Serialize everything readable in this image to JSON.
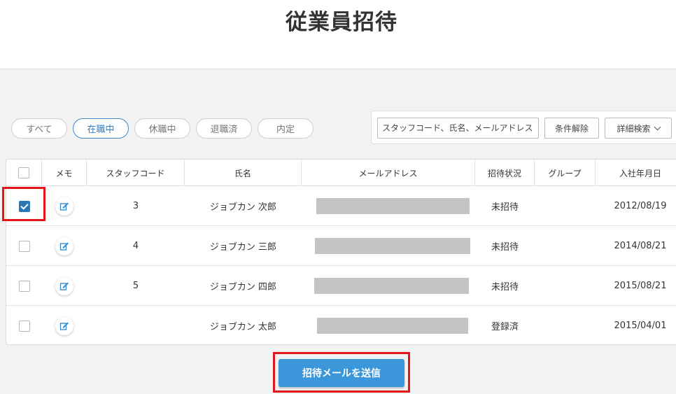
{
  "page": {
    "title": "従業員招待"
  },
  "filters": {
    "tabs": [
      {
        "label": "すべて",
        "active": false
      },
      {
        "label": "在職中",
        "active": true
      },
      {
        "label": "休職中",
        "active": false
      },
      {
        "label": "退職済",
        "active": false
      },
      {
        "label": "内定",
        "active": false
      }
    ]
  },
  "search": {
    "placeholder": "スタッフコード、氏名、メールアドレス",
    "value": "",
    "clear_label": "条件解除",
    "advanced_label": "詳細検索"
  },
  "table": {
    "columns": [
      "メモ",
      "スタッフコード",
      "氏名",
      "メールアドレス",
      "招待状況",
      "グループ",
      "入社年月日"
    ],
    "rows": [
      {
        "checked": true,
        "code": "3",
        "name": "ジョブカン 次郎",
        "status": "未招待",
        "group": "",
        "join_date": "2012/08/19"
      },
      {
        "checked": false,
        "code": "4",
        "name": "ジョブカン 三郎",
        "status": "未招待",
        "group": "",
        "join_date": "2014/08/21"
      },
      {
        "checked": false,
        "code": "5",
        "name": "ジョブカン 四郎",
        "status": "未招待",
        "group": "",
        "join_date": "2015/08/21"
      },
      {
        "checked": false,
        "code": "",
        "name": "ジョブカン 太郎",
        "status": "登録済",
        "group": "",
        "join_date": "2015/04/01"
      }
    ]
  },
  "actions": {
    "send_label": "招待メールを送信"
  },
  "colors": {
    "accent": "#3b97d9",
    "highlight": "#e3151a",
    "checkbox_checked": "#2b78b8"
  }
}
